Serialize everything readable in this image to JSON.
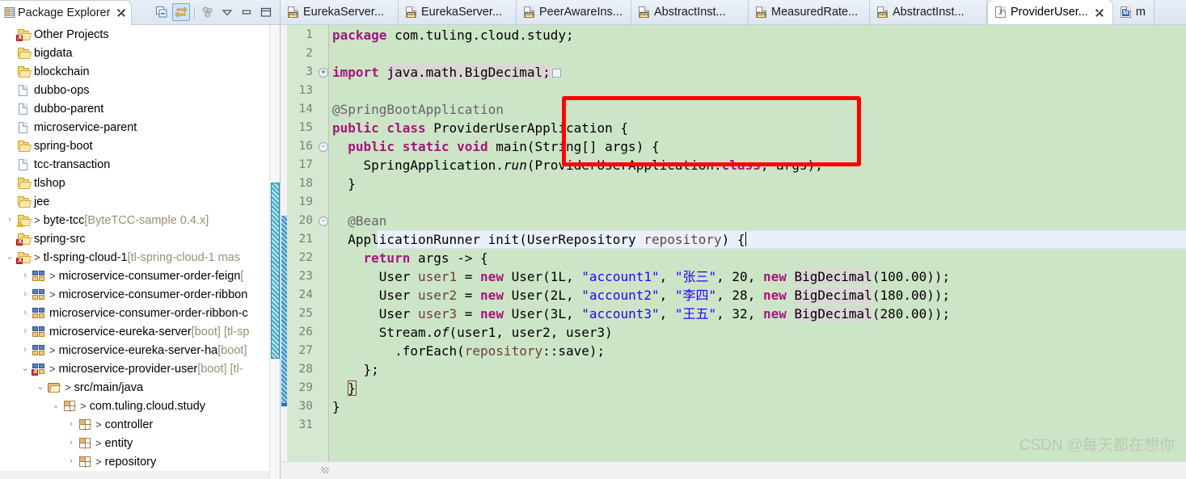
{
  "explorer": {
    "title": "Package Explorer",
    "close_icon": "close-icon",
    "toolbar": [
      {
        "name": "collapse-all-icon",
        "label": "Collapse All"
      },
      {
        "name": "link-with-editor-icon",
        "label": "Link with Editor",
        "active": true
      },
      {
        "name": "focus-on-active-task-icon",
        "label": "Focus on Active Task"
      },
      {
        "name": "view-menu-icon",
        "label": "View Menu"
      },
      {
        "name": "minimize-icon",
        "label": "Minimize"
      },
      {
        "name": "maximize-icon",
        "label": "Maximize"
      }
    ],
    "tree": [
      {
        "label": "Other Projects",
        "suffix": "",
        "indent": 0,
        "twisty": "",
        "icon": "folder-error-icon",
        "arrow": false
      },
      {
        "label": "bigdata",
        "suffix": "",
        "indent": 0,
        "twisty": "",
        "icon": "folder-icon",
        "arrow": false
      },
      {
        "label": "blockchain",
        "suffix": "",
        "indent": 0,
        "twisty": "",
        "icon": "folder-icon",
        "arrow": false
      },
      {
        "label": "dubbo-ops",
        "suffix": "",
        "indent": 0,
        "twisty": "",
        "icon": "doc-icon",
        "arrow": false
      },
      {
        "label": "dubbo-parent",
        "suffix": "",
        "indent": 0,
        "twisty": "",
        "icon": "doc-icon",
        "arrow": false
      },
      {
        "label": "microservice-parent",
        "suffix": "",
        "indent": 0,
        "twisty": "",
        "icon": "doc-icon",
        "arrow": false
      },
      {
        "label": "spring-boot",
        "suffix": "",
        "indent": 0,
        "twisty": "",
        "icon": "folder-icon",
        "arrow": false
      },
      {
        "label": "tcc-transaction",
        "suffix": "",
        "indent": 0,
        "twisty": "",
        "icon": "doc-icon",
        "arrow": false
      },
      {
        "label": "tlshop",
        "suffix": "",
        "indent": 0,
        "twisty": "",
        "icon": "folder-icon",
        "arrow": false
      },
      {
        "label": "jee",
        "suffix": "",
        "indent": 0,
        "twisty": "",
        "icon": "folder-icon",
        "arrow": false
      },
      {
        "label": "byte-tcc",
        "suffix": "[ByteTCC-sample 0.4.x]",
        "indent": 0,
        "twisty": "›",
        "icon": "maven-warn-icon",
        "arrow": true
      },
      {
        "label": "spring-src",
        "suffix": "",
        "indent": 0,
        "twisty": "",
        "icon": "folder-error-icon",
        "arrow": false
      },
      {
        "label": "tl-spring-cloud-1",
        "suffix": "[tl-spring-cloud-1 mas",
        "indent": 0,
        "twisty": "⌄",
        "icon": "maven-error-icon",
        "arrow": true
      },
      {
        "label": "microservice-consumer-order-feign",
        "suffix": "[",
        "indent": 1,
        "twisty": "›",
        "icon": "ms-project-icon",
        "arrow": true
      },
      {
        "label": "microservice-consumer-order-ribbon",
        "suffix": "",
        "indent": 1,
        "twisty": "›",
        "icon": "ms-project-icon",
        "arrow": true
      },
      {
        "label": "microservice-consumer-order-ribbon-c",
        "suffix": "",
        "indent": 1,
        "twisty": "›",
        "icon": "ms-project-icon",
        "arrow": false
      },
      {
        "label": "microservice-eureka-server",
        "suffix": "[boot] [tl-sp",
        "indent": 1,
        "twisty": "›",
        "icon": "ms-project-icon",
        "arrow": false
      },
      {
        "label": "microservice-eureka-server-ha",
        "suffix": "[boot]",
        "indent": 1,
        "twisty": "›",
        "icon": "ms-project-icon",
        "arrow": true
      },
      {
        "label": "microservice-provider-user",
        "suffix": "[boot] [tl-",
        "indent": 1,
        "twisty": "⌄",
        "icon": "ms-project-error-icon",
        "arrow": true
      },
      {
        "label": "src/main/java",
        "suffix": "",
        "indent": 2,
        "twisty": "⌄",
        "icon": "source-folder-icon",
        "arrow": true
      },
      {
        "label": "com.tuling.cloud.study",
        "suffix": "",
        "indent": 3,
        "twisty": "⌄",
        "icon": "package-icon",
        "arrow": true
      },
      {
        "label": "controller",
        "suffix": "",
        "indent": 4,
        "twisty": "›",
        "icon": "package-icon",
        "arrow": true
      },
      {
        "label": "entity",
        "suffix": "",
        "indent": 4,
        "twisty": "›",
        "icon": "package-icon",
        "arrow": true
      },
      {
        "label": "repository",
        "suffix": "",
        "indent": 4,
        "twisty": "›",
        "icon": "package-icon",
        "arrow": true
      }
    ]
  },
  "editor_tabs": [
    {
      "label": "EurekaServer...",
      "icon": "class-file-icon",
      "active": false,
      "closable": false
    },
    {
      "label": "EurekaServer...",
      "icon": "class-file-icon",
      "active": false,
      "closable": false
    },
    {
      "label": "PeerAwareIns...",
      "icon": "class-file-icon",
      "active": false,
      "closable": false
    },
    {
      "label": "AbstractInst...",
      "icon": "class-file-icon",
      "active": false,
      "closable": false
    },
    {
      "label": "MeasuredRate...",
      "icon": "class-file-icon",
      "active": false,
      "closable": false
    },
    {
      "label": "AbstractInst...",
      "icon": "class-file-icon",
      "active": false,
      "closable": false
    },
    {
      "label": "ProviderUser...",
      "icon": "java-file-icon",
      "active": true,
      "closable": true
    },
    {
      "label": "m",
      "icon": "xml-file-icon",
      "active": false,
      "closable": false
    }
  ],
  "code": {
    "file_background": "#cde5c7",
    "gutter_background": "#d6e8d0",
    "current_line": 21,
    "highlight_box": {
      "color": "#ff0000",
      "from_line": 13,
      "to_line": 15
    },
    "lines": [
      {
        "n": 1,
        "tokens": [
          {
            "t": "package ",
            "c": "k"
          },
          {
            "t": "com.tuling.cloud.study;",
            "c": ""
          }
        ]
      },
      {
        "n": 2,
        "tokens": []
      },
      {
        "n": 3,
        "fold": "+",
        "collapsed": true,
        "tokens": [
          {
            "t": "import ",
            "c": "k"
          },
          {
            "t": "java.math.BigDecimal;",
            "c": "occ"
          }
        ]
      },
      {
        "n": 13,
        "tokens": []
      },
      {
        "n": 14,
        "tokens": [
          {
            "t": "@SpringBootApplication",
            "c": "an"
          }
        ]
      },
      {
        "n": 15,
        "tokens": [
          {
            "t": "public class ",
            "c": "k"
          },
          {
            "t": "ProviderUserApplication {",
            "c": ""
          }
        ]
      },
      {
        "n": 16,
        "fold": "-",
        "tokens": [
          {
            "t": "  ",
            "c": ""
          },
          {
            "t": "public static void ",
            "c": "k"
          },
          {
            "t": "main(String[] args) {",
            "c": ""
          }
        ]
      },
      {
        "n": 17,
        "tokens": [
          {
            "t": "    SpringApplication.",
            "c": ""
          },
          {
            "t": "run",
            "c": "it"
          },
          {
            "t": "(ProviderUserApplication.",
            "c": ""
          },
          {
            "t": "class",
            "c": "k"
          },
          {
            "t": ", args);",
            "c": ""
          }
        ]
      },
      {
        "n": 18,
        "tokens": [
          {
            "t": "  }",
            "c": ""
          }
        ]
      },
      {
        "n": 19,
        "tokens": []
      },
      {
        "n": 20,
        "fold": "-",
        "tokens": [
          {
            "t": "  @Bean",
            "c": "an"
          }
        ]
      },
      {
        "n": 21,
        "tokens": [
          {
            "t": "  ApplicationRunner init(UserRepository ",
            "c": ""
          },
          {
            "t": "repository",
            "c": "fld"
          },
          {
            "t": ") {",
            "c": ""
          }
        ]
      },
      {
        "n": 22,
        "tokens": [
          {
            "t": "    ",
            "c": ""
          },
          {
            "t": "return ",
            "c": "k"
          },
          {
            "t": "args -> {",
            "c": ""
          }
        ]
      },
      {
        "n": 23,
        "tokens": [
          {
            "t": "      User ",
            "c": ""
          },
          {
            "t": "user1",
            "c": "fld"
          },
          {
            "t": " = ",
            "c": ""
          },
          {
            "t": "new ",
            "c": "k"
          },
          {
            "t": "User(1L, ",
            "c": ""
          },
          {
            "t": "\"account1\"",
            "c": "s"
          },
          {
            "t": ", ",
            "c": ""
          },
          {
            "t": "\"张三\"",
            "c": "s"
          },
          {
            "t": ", 20, ",
            "c": ""
          },
          {
            "t": "new ",
            "c": "k"
          },
          {
            "t": "BigDecimal",
            "c": "occ"
          },
          {
            "t": "(100.00));",
            "c": ""
          }
        ]
      },
      {
        "n": 24,
        "tokens": [
          {
            "t": "      User ",
            "c": ""
          },
          {
            "t": "user2",
            "c": "fld"
          },
          {
            "t": " = ",
            "c": ""
          },
          {
            "t": "new ",
            "c": "k"
          },
          {
            "t": "User(2L, ",
            "c": ""
          },
          {
            "t": "\"account2\"",
            "c": "s"
          },
          {
            "t": ", ",
            "c": ""
          },
          {
            "t": "\"李四\"",
            "c": "s"
          },
          {
            "t": ", 28, ",
            "c": ""
          },
          {
            "t": "new ",
            "c": "k"
          },
          {
            "t": "BigDecimal",
            "c": "occ"
          },
          {
            "t": "(180.00));",
            "c": ""
          }
        ]
      },
      {
        "n": 25,
        "tokens": [
          {
            "t": "      User ",
            "c": ""
          },
          {
            "t": "user3",
            "c": "fld"
          },
          {
            "t": " = ",
            "c": ""
          },
          {
            "t": "new ",
            "c": "k"
          },
          {
            "t": "User(3L, ",
            "c": ""
          },
          {
            "t": "\"account3\"",
            "c": "s"
          },
          {
            "t": ", ",
            "c": ""
          },
          {
            "t": "\"王五\"",
            "c": "s"
          },
          {
            "t": ", 32, ",
            "c": ""
          },
          {
            "t": "new ",
            "c": "k"
          },
          {
            "t": "BigDecimal",
            "c": "occ"
          },
          {
            "t": "(280.00));",
            "c": ""
          }
        ]
      },
      {
        "n": 26,
        "tokens": [
          {
            "t": "      Stream.",
            "c": ""
          },
          {
            "t": "of",
            "c": "it"
          },
          {
            "t": "(user1, user2, user3)",
            "c": ""
          }
        ]
      },
      {
        "n": 27,
        "tokens": [
          {
            "t": "        .forEach(",
            "c": ""
          },
          {
            "t": "repository",
            "c": "fld"
          },
          {
            "t": "::save);",
            "c": ""
          }
        ]
      },
      {
        "n": 28,
        "tokens": [
          {
            "t": "    };",
            "c": ""
          }
        ]
      },
      {
        "n": 29,
        "tokens": [
          {
            "t": "  }",
            "c": ""
          }
        ]
      },
      {
        "n": 30,
        "tokens": [
          {
            "t": "}",
            "c": ""
          }
        ]
      },
      {
        "n": 31,
        "tokens": []
      }
    ]
  },
  "watermark": "CSDN @每天都在想你",
  "colors": {
    "editor_bg": "#cde5c7",
    "gutter_bg": "#d6e8d0",
    "current_line_bg": "#eaf0fb",
    "keyword": "#a3177c",
    "string": "#2a00ff",
    "annotation": "#646464",
    "field": "#6a3e3e",
    "occurrence_bg": "#dcd6d6",
    "highlight_rect": "#ff0000",
    "changebar": "#2f8dbe"
  }
}
